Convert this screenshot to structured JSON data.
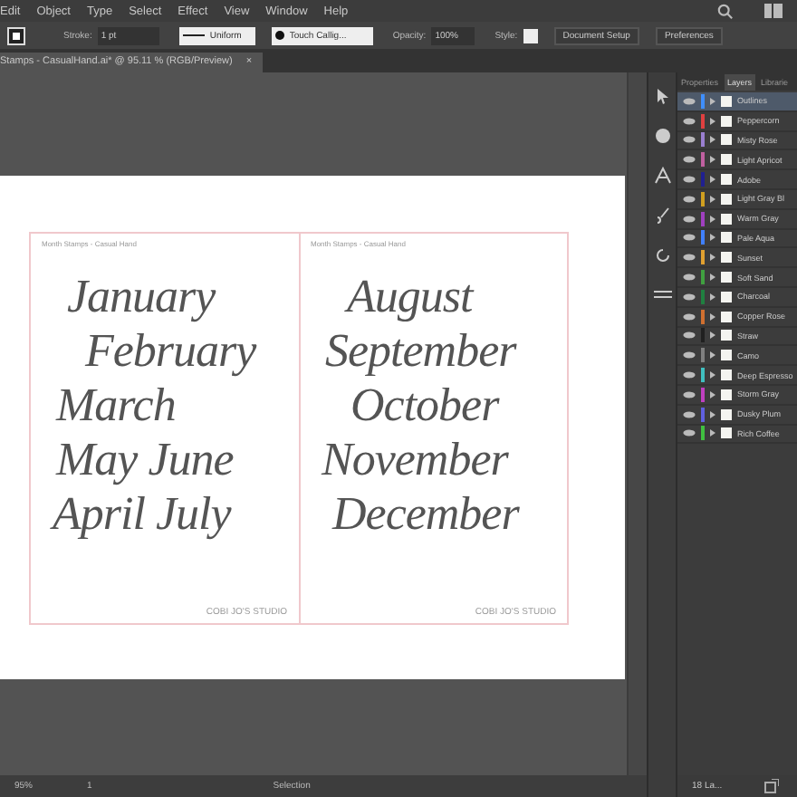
{
  "menu": [
    "Edit",
    "Object",
    "Type",
    "Select",
    "Effect",
    "View",
    "Window",
    "Help"
  ],
  "control_bar": {
    "stroke_label": "Stroke:",
    "stroke_weight": "1 pt",
    "profile": "Uniform",
    "brush": "Touch Callig...",
    "opacity_label": "Opacity:",
    "opacity": "100%",
    "style_label": "Style:",
    "buttons": [
      "Document Setup",
      "Preferences"
    ]
  },
  "document_tab": {
    "title": "Stamps - CasualHand.ai* @ 95.11 % (RGB/Preview)",
    "close": "×"
  },
  "artboards": [
    {
      "header": "Month Stamps - Casual Hand",
      "lines": [
        "January",
        "February",
        "March",
        "May June",
        "April July"
      ],
      "footer": "COBI JO'S STUDIO"
    },
    {
      "header": "Month Stamps - Casual Hand",
      "lines": [
        "August",
        "September",
        "October",
        "November",
        "December"
      ],
      "footer": "COBI JO'S STUDIO"
    }
  ],
  "status_bar": {
    "zoom": "95%",
    "artboard": "1",
    "tool": "Selection"
  },
  "panel_tabs": [
    {
      "label": "Properties",
      "selected": false
    },
    {
      "label": "Layers",
      "selected": true
    },
    {
      "label": "Librarie",
      "selected": false
    }
  ],
  "layers": [
    {
      "name": "Outlines",
      "color": "#3f8fff",
      "selected": true
    },
    {
      "name": "Peppercorn",
      "color": "#e04040",
      "selected": false
    },
    {
      "name": "Misty Rose",
      "color": "#9a7fd0",
      "selected": false
    },
    {
      "name": "Light Apricot",
      "color": "#c060a0",
      "selected": false
    },
    {
      "name": "Adobe",
      "color": "#202090",
      "selected": false
    },
    {
      "name": "Light Gray Bl",
      "color": "#d0a020",
      "selected": false
    },
    {
      "name": "Warm Gray",
      "color": "#a040c0",
      "selected": false
    },
    {
      "name": "Pale Aqua",
      "color": "#4080ff",
      "selected": false
    },
    {
      "name": "Sunset",
      "color": "#e0a030",
      "selected": false
    },
    {
      "name": "Soft Sand",
      "color": "#40a040",
      "selected": false
    },
    {
      "name": "Charcoal",
      "color": "#208040",
      "selected": false
    },
    {
      "name": "Copper Rose",
      "color": "#d07030",
      "selected": false
    },
    {
      "name": "Straw",
      "color": "#202020",
      "selected": false
    },
    {
      "name": "Camo",
      "color": "#808080",
      "selected": false
    },
    {
      "name": "Deep Espresso",
      "color": "#40c0c0",
      "selected": false
    },
    {
      "name": "Storm Gray",
      "color": "#c040c0",
      "selected": false
    },
    {
      "name": "Dusky Plum",
      "color": "#6060e0",
      "selected": false
    },
    {
      "name": "Rich Coffee",
      "color": "#40c040",
      "selected": false
    }
  ],
  "layer_count": "18 La..."
}
